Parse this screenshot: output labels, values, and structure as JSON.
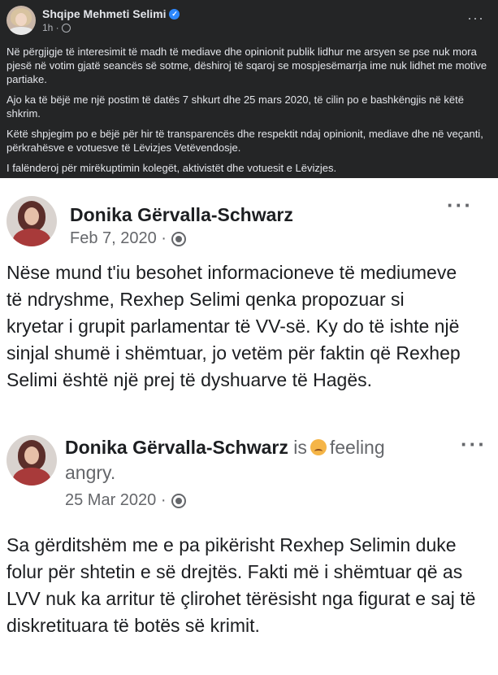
{
  "header_post": {
    "author": "Shqipe Mehmeti Selimi",
    "time": "1h ·",
    "more": "···",
    "paragraphs": [
      "Në përgjigje të interesimit të madh të mediave dhe opinionit publik lidhur me arsyen se pse nuk mora pjesë në votim gjatë seancës së sotme, dëshiroj të sqaroj se mospjesëmarrja ime nuk lidhet me motive partiake.",
      "Ajo ka të bëjë me një postim të datës 7 shkurt dhe 25 mars 2020, të cilin po e bashkëngjis në këtë shkrim.",
      "Këtë shpjegim po e bëjë për hir të transparencës dhe respektit ndaj opinionit, mediave dhe në veçanti, përkrahësve e votuesve të Lëvizjes Vetëvendosje.",
      "I falënderoj për mirëkuptimin kolegët, aktivistët dhe votuesit e Lëvizjes."
    ]
  },
  "embedded_posts": [
    {
      "author": "Donika Gërvalla-Schwarz",
      "date": "Feb 7, 2020 ·",
      "more": "···",
      "text": "Nëse mund t'iu besohet informacioneve të mediumeve të ndryshme, Rexhep Selimi qenka propozuar si kryetar i grupit parlamentar të VV-së. Ky do të ishte një sinjal shumë i shëmtuar, jo vetëm për faktin që Rexhep Selimi është një prej të dyshuarve të Hagës."
    },
    {
      "author": "Donika Gërvalla-Schwarz",
      "feeling_prefix": "is",
      "feeling_word": "feeling",
      "feeling_value": "angry.",
      "date": "25 Mar 2020 ·",
      "more": "···",
      "text": "Sa gërditshëm me e pa pikërisht Rexhep Selimin duke folur për shtetin e së drejtës. Fakti më i shëmtuar që as LVV nuk ka arritur të çlirohet tërësisht nga figurat e saj të diskretituara të botës së krimit."
    }
  ]
}
